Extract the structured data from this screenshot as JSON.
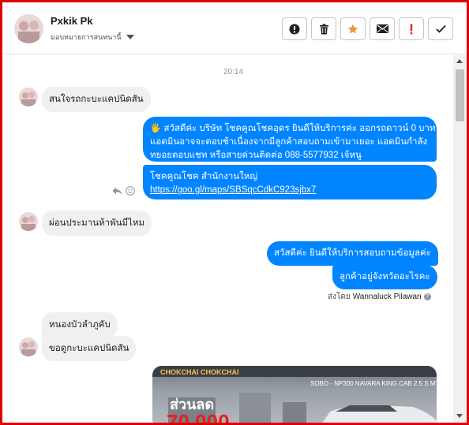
{
  "header": {
    "contact_name": "Pxkik Pk",
    "assign_label": "มอบหมายการสนทนานี้",
    "actions": [
      {
        "name": "alert-icon"
      },
      {
        "name": "trash-icon"
      },
      {
        "name": "star-icon"
      },
      {
        "name": "mail-icon"
      },
      {
        "name": "exclamation-icon"
      },
      {
        "name": "check-icon"
      }
    ]
  },
  "chat": {
    "timestamp": "20:14",
    "messages": {
      "in1": "สนใจรถกะบะแคปนิดสัน",
      "out1_line1": "🖐 สวัสดีค่ะ บริษัท โชคคูณโชคอุดร ยินดีให้บริการค่ะ ออกรถดาวน์ 0 บาท",
      "out1_line2": "แอดมินอาจจะตอบช้าเนื่องจากมีลูกค้าสอบถามเข้ามาเยอะ แอดมินกำลัง",
      "out1_line3": "ทยอยตอบแชท หรือสายด่วนติดต่อ 088-5577932 เจ้หนู",
      "out2_line1": "โชคคูณโชค สำนักงานใหญ่",
      "out2_link": "https://goo.gl/maps/SBSqcCdkC923sjbx7",
      "in2": "ผ่อนประมานห้าพันมีไหม",
      "out3": "สวัสดีค่ะ  ยินดีให้บริการสอบถามข้อมูลค่ะ",
      "out4": "ลูกค้าอยู่จังหวัดอะไรคะ",
      "sent_by_prefix": "ส่งโดย",
      "sent_by_name": "Wannaluck Pilawan",
      "in3": "หนองบัวลำภูคับ",
      "in4": "ขอดูกะบะแคปนิดสัน"
    },
    "promo": {
      "top_text": "SOBO - NP300 NAVARA KING CAB 2.5 S MT",
      "discount_label": "ส่วนลด",
      "brand_text": "CHOKCHAI CHOKCHAI",
      "amount": "70,000"
    }
  },
  "colors": {
    "frame": "#e10000",
    "outgoing": "#0084ff",
    "incoming": "#f1f0f0",
    "star": "#f7923a",
    "exclamation": "#e02424"
  }
}
